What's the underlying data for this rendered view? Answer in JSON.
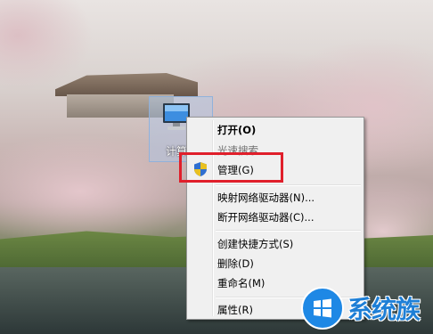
{
  "desktop": {
    "icon_label": "计算机"
  },
  "context_menu": {
    "items": [
      {
        "label": "打开(O)",
        "bold": true
      },
      {
        "label": "光速搜索"
      },
      {
        "label": "管理(G)"
      },
      {
        "label": "映射网络驱动器(N)..."
      },
      {
        "label": "断开网络驱动器(C)..."
      },
      {
        "label": "创建快捷方式(S)"
      },
      {
        "label": "删除(D)"
      },
      {
        "label": "重命名(M)"
      },
      {
        "label": "属性(R)"
      }
    ]
  },
  "annotation": {
    "highlight_color": "#e01f2b",
    "highlight_target": "管理(G)"
  },
  "watermark": {
    "text": "系统族",
    "color": "#1e7fd6"
  }
}
